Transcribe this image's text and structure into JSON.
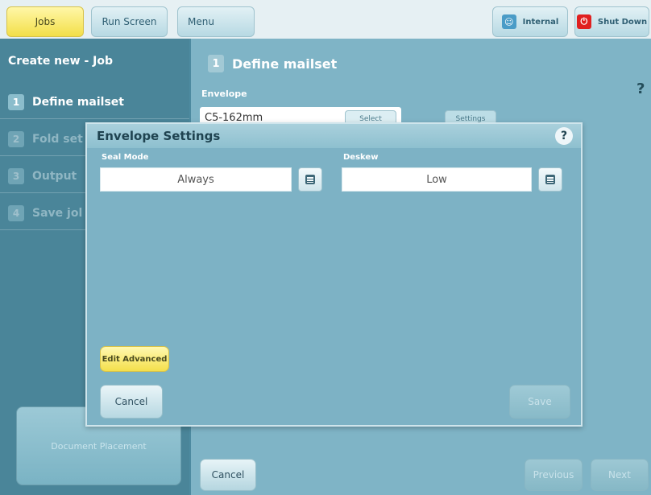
{
  "topbar": {
    "jobs": "Jobs",
    "run_screen": "Run Screen",
    "menu": "Menu",
    "internal": "Internal",
    "shut_down": "Shut Down"
  },
  "left": {
    "heading": "Create new - Job",
    "steps": [
      {
        "num": "1",
        "label": "Define mailset"
      },
      {
        "num": "2",
        "label": "Fold set"
      },
      {
        "num": "3",
        "label": "Output"
      },
      {
        "num": "4",
        "label": "Save jol"
      }
    ],
    "document_placement": "Document Placement"
  },
  "main": {
    "step_num": "1",
    "title": "Define mailset",
    "envelope_label": "Envelope",
    "envelope_value": "C5-162mm",
    "select_label": "Select",
    "settings_label": "Settings",
    "help": "?"
  },
  "bottom": {
    "cancel": "Cancel",
    "previous": "Previous",
    "next": "Next"
  },
  "dialog": {
    "title": "Envelope Settings",
    "help": "?",
    "seal_mode_label": "Seal Mode",
    "seal_mode_value": "Always",
    "deskew_label": "Deskew",
    "deskew_value": "Low",
    "edit_advanced": "Edit Advanced",
    "cancel": "Cancel",
    "save": "Save"
  },
  "colors": {
    "accent_yellow": "#f3df48",
    "background": "#4d8aa0",
    "shutdown_red": "#e02020",
    "internal_blue": "#4a9cc7"
  }
}
